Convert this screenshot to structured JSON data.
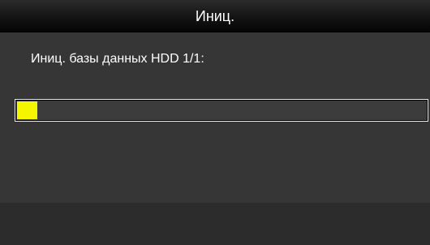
{
  "dialog": {
    "title": "Иниц.",
    "status_text": "Иниц. базы данных HDD 1/1:",
    "progress_fraction": 0.05,
    "colors": {
      "progress_fill": "#f5f500",
      "title_bar": "#141414",
      "body": "#363636",
      "footer": "#2c2c2c"
    }
  }
}
